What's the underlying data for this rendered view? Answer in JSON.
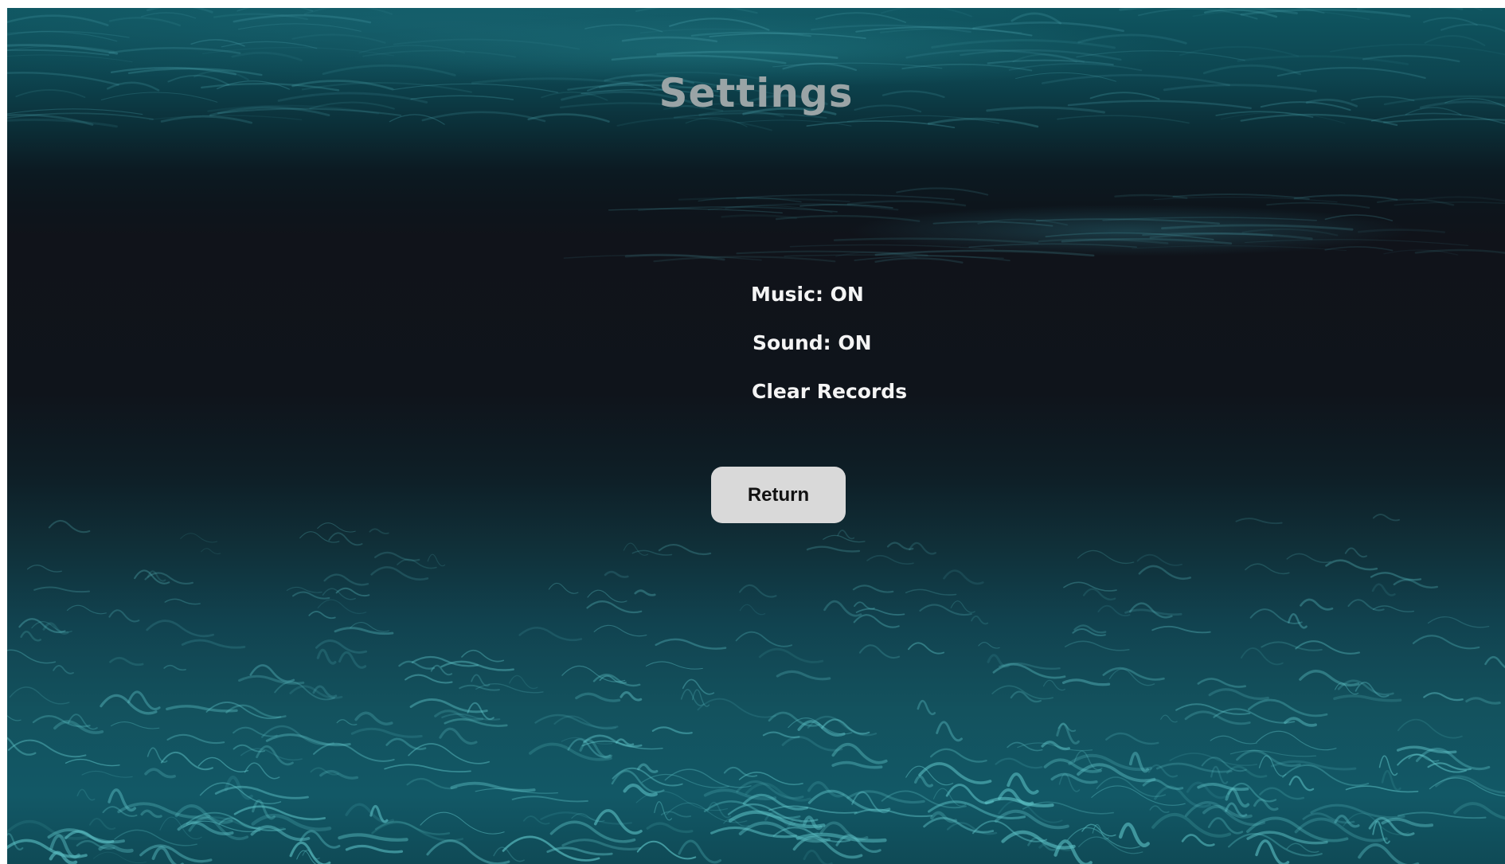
{
  "screen": {
    "title": "Settings"
  },
  "menu": {
    "music_label": "Music: ON",
    "sound_label": "Sound: ON",
    "clear_records_label": "Clear Records"
  },
  "actions": {
    "return_label": "Return"
  },
  "colors": {
    "title": "#9aa4a6",
    "menu_text": "#f4f4f4",
    "button_bg": "#d9d9d9",
    "button_text": "#111111",
    "water_deep": "#10131a",
    "water_light": "#13525e"
  }
}
